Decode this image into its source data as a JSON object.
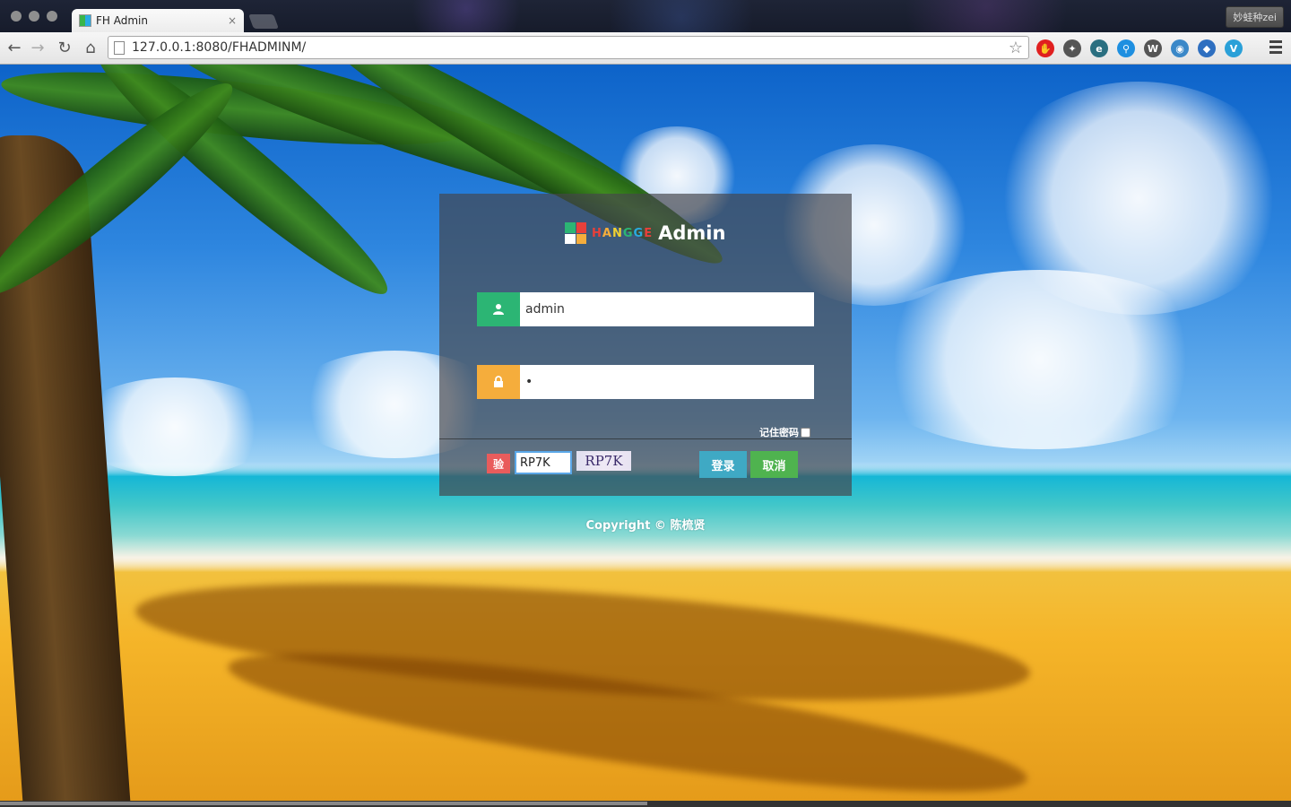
{
  "browser": {
    "tab_title": "FH Admin",
    "tab_close": "×",
    "url": "127.0.0.1:8080/FHADMINM/",
    "profile_name": "妙蛙种zei",
    "back_icon": "arrow-left-icon",
    "forward_icon": "arrow-right-icon",
    "reload_icon": "reload-icon",
    "home_icon": "home-icon",
    "star_icon": "star-icon",
    "extensions": [
      {
        "name": "adblock-icon",
        "glyph": "✋",
        "color": "#e02020"
      },
      {
        "name": "tools-icon",
        "glyph": "✦",
        "color": "#555555"
      },
      {
        "name": "e-icon",
        "glyph": "e",
        "color": "#2a6f80"
      },
      {
        "name": "search-ext-icon",
        "glyph": "⚲",
        "color": "#1e8fe0"
      },
      {
        "name": "wikipedia-icon",
        "glyph": "W",
        "color": "#555555"
      },
      {
        "name": "screen-icon",
        "glyph": "◉",
        "color": "#3a88c8"
      },
      {
        "name": "bird-icon",
        "glyph": "◆",
        "color": "#2e6fc0"
      },
      {
        "name": "vimeo-icon",
        "glyph": "V",
        "color": "#2aa0d8"
      }
    ]
  },
  "login": {
    "logo_brand": "HANGGE",
    "logo_brand_colors": [
      "#e8403a",
      "#f5ad3c",
      "#f0d030",
      "#2cb574",
      "#29abe2",
      "#e8403a"
    ],
    "logo_admin": "Admin",
    "username_value": "admin",
    "password_value": "•",
    "remember_label": "记住密码",
    "captcha_label": "验",
    "captcha_value": "RP7K",
    "captcha_image_text": "RP7K",
    "login_button": "登录",
    "cancel_button": "取消",
    "user_icon": "user-icon",
    "lock_icon": "lock-icon"
  },
  "copyright": "Copyright © 陈梳贤",
  "colors": {
    "user_icon_bg": "#2cb574",
    "lock_icon_bg": "#f5ad3c",
    "captcha_label_bg": "#e95c5c",
    "login_button_bg": "#3fa9c4",
    "cancel_button_bg": "#4fb34f"
  }
}
